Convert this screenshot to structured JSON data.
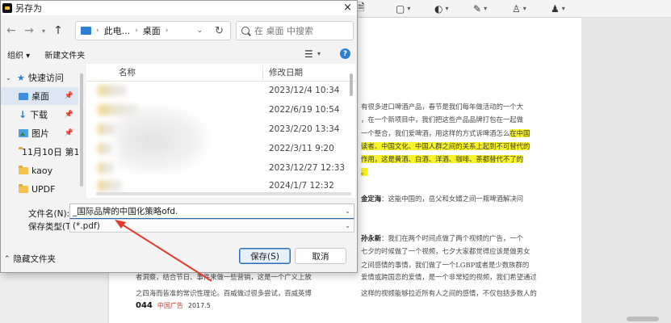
{
  "dialog": {
    "title": "另存为",
    "close_glyph": "×",
    "nav": {
      "back": "←",
      "forward": "→",
      "up": "↑",
      "breadcrumb": [
        "此电...",
        "桌面"
      ],
      "crumb_sep": "›",
      "search_placeholder": "在 桌面 中搜索"
    },
    "commands": {
      "organize": "组织 ▾",
      "new_folder": "新建文件夹",
      "help": "?"
    },
    "sidebar": {
      "items": [
        {
          "label": "快速访问"
        },
        {
          "label": "桌面"
        },
        {
          "label": "下载"
        },
        {
          "label": "图片"
        },
        {
          "label": "11月10日 第1"
        },
        {
          "label": "kaoy"
        },
        {
          "label": "UPDF"
        }
      ]
    },
    "filelist": {
      "columns": {
        "name": "名称",
        "modified": "修改日期"
      },
      "rows": [
        {
          "modified": "2023/12/4 10:34"
        },
        {
          "modified": "2022/6/19 10:54"
        },
        {
          "modified": "2023/2/20 13:34"
        },
        {
          "modified": "2022/3/11 9:20"
        },
        {
          "modified": "2023/12/27 12:33"
        },
        {
          "modified": "2024/1/7 12:32"
        }
      ]
    },
    "filename_label": "文件名(N):",
    "filename_value": "_国际品牌的中国化策略ofd.",
    "filetype_label": "保存类型(T):",
    "filetype_value": "(*.pdf)",
    "hide_folders": "隐藏文件夹",
    "save_button": "保存(S)",
    "cancel_button": "取消"
  },
  "document": {
    "article_lines": [
      {
        "text": "有很多进口啤酒产品，春节是我们每年做活动的一个大",
        "hl": ""
      },
      {
        "text": "，在一个新项目中，我们把这些产品品牌打包在一起做",
        "hl": ""
      },
      {
        "text": "一个整合，我们爱啤酒，用这样的方式诉啤酒怎么",
        "hl": "在中国"
      },
      {
        "text": "",
        "hl": "读者、中国文化、中国人群之间的关系上起到不可替代的"
      },
      {
        "text": "",
        "hl": "作用，这是黄酒、白酒、洋酒、咖啡、茶都替代不了的"
      },
      {
        "text": "",
        "hl": "。"
      },
      {
        "text": "",
        "hl": ""
      },
      {
        "text": "金定海：这能中国的，岳父和女婿之间一瓶啤酒解决问",
        "hl": ""
      },
      {
        "text": "",
        "hl": ""
      },
      {
        "text": "",
        "hl": ""
      },
      {
        "text": "孙永新：我们在两个时间点做了两个视频的广告，一个",
        "hl": ""
      },
      {
        "text": "七夕的时候做了一个视频，七夕大家都觉得应该是做男女",
        "hl": ""
      },
      {
        "text": "之间感情的事情，我们做了一个LGBP或者是少数族群的",
        "hl": ""
      }
    ],
    "bottom_left_lines": [
      "者洞察，结合节日、事件来做一些营销，这是一个广义上放",
      "之四海而皆准的常识性理论。百威做过很多尝试，百威英博"
    ],
    "bottom_right_lines": [
      "爱情或跨国恋的爱情，是一个非常短的视频，我们希望通过",
      "这样的视频能够拉近所有人之间的感情，不仅包括多数人的"
    ],
    "page_number": "044",
    "publication": "中国广告",
    "issue": "2017.5"
  },
  "colors": {
    "highlight": "#f7f32a",
    "accent": "#2b6cb0",
    "annotation_arrow": "#e03b2e"
  }
}
